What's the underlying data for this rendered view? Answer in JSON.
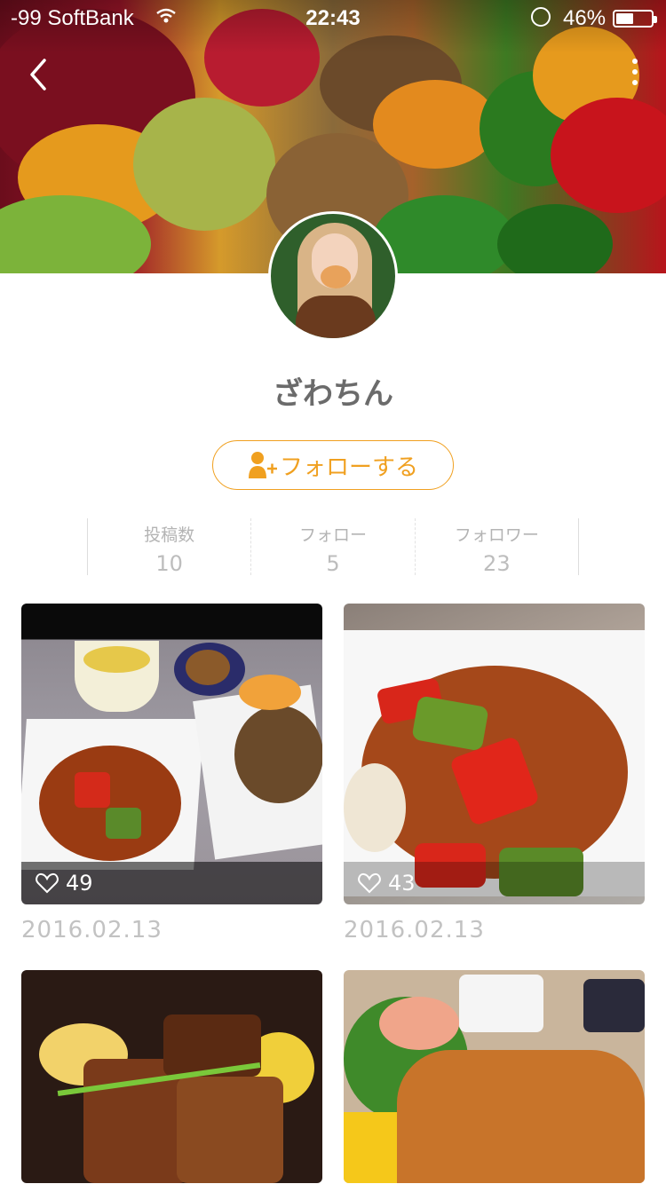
{
  "status_bar": {
    "carrier": "-99 SoftBank",
    "time": "22:43",
    "battery": "46%",
    "battery_level": 0.46
  },
  "profile": {
    "name": "ざわちん",
    "follow_label": "フォローする"
  },
  "stats": [
    {
      "label": "投稿数",
      "value": "10"
    },
    {
      "label": "フォロー",
      "value": "5"
    },
    {
      "label": "フォロワー",
      "value": "23"
    }
  ],
  "posts": [
    {
      "likes": "49",
      "date": "2016.02.13"
    },
    {
      "likes": "43",
      "date": "2016.02.13"
    },
    {
      "likes": "",
      "date": ""
    },
    {
      "likes": "",
      "date": ""
    }
  ],
  "colors": {
    "accent": "#f0a020",
    "text_gray": "#6b6b6b"
  }
}
